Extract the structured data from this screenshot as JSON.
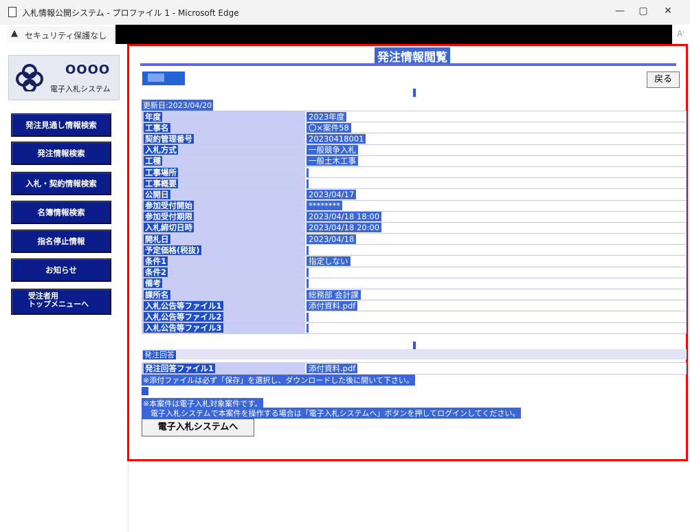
{
  "window": {
    "title": "入札情報公開システム - プロファイル 1 - Microsoft Edge",
    "minimize": "—",
    "restore": "▢",
    "close": "✕"
  },
  "addressbar": {
    "security_text": "セキュリティ保護なし",
    "warning_icon": "▲",
    "read_icon": "A⁾"
  },
  "logo": {
    "org": "OOOO",
    "system": "電子入札システム"
  },
  "nav": [
    {
      "label": "発注見通し情報検索"
    },
    {
      "label": "発注情報検索"
    },
    {
      "label": "入札・契約情報検索"
    },
    {
      "label": "名簿情報検索"
    },
    {
      "label": "指名停止情報"
    },
    {
      "label": "お知らせ"
    },
    {
      "label_line1": "受注者用",
      "label_line2": "トップメニューへ"
    }
  ],
  "page": {
    "title": "発注情報閲覧",
    "back_button": "戻る",
    "updated": "更新日:2023/04/20"
  },
  "info_rows": [
    {
      "label": "年度",
      "value": "2023年度"
    },
    {
      "label": "工事名",
      "value": "〇×案件58"
    },
    {
      "label": "契約管理番号",
      "value": "20230418001"
    },
    {
      "label": "入札方式",
      "value": "一般競争入札"
    },
    {
      "label": "工種",
      "value": "一般土木工事"
    },
    {
      "label": "工事場所",
      "value": ""
    },
    {
      "label": "工事概要",
      "value": ""
    },
    {
      "label": "公開日",
      "value": "2023/04/17"
    },
    {
      "label": "参加受付開始",
      "value": "********"
    },
    {
      "label": "参加受付期限",
      "value": "2023/04/18 18:00"
    },
    {
      "label": "入札締切日時",
      "value": "2023/04/18 20:00"
    },
    {
      "label": "開札日",
      "value": "2023/04/18"
    },
    {
      "label": "予定価格(税抜)",
      "value": ""
    },
    {
      "label": "条件1",
      "value": "指定しない"
    },
    {
      "label": "条件2",
      "value": ""
    },
    {
      "label": "備考",
      "value": ""
    },
    {
      "label": "課所名",
      "value": "総務部 会計課"
    },
    {
      "label": "入札公告等ファイル1",
      "value": "添付資料.pdf"
    },
    {
      "label": "入札公告等ファイル2",
      "value": ""
    },
    {
      "label": "入札公告等ファイル3",
      "value": ""
    }
  ],
  "answer": {
    "section_title": "発注回答",
    "label": "発注回答ファイル1",
    "value": "添付資料.pdf"
  },
  "notes": {
    "attachment": "※添付ファイルは必ず「保存」を選択し、ダウンロードした後に開いて下さい。",
    "electronic_1": "※本案件は電子入札対象案件です。",
    "electronic_2": "　電子入札システムで本案件を操作する場合は「電子入札システムへ」ボタンを押してログインしてください。"
  },
  "sys_button": "電子入札システムへ"
}
